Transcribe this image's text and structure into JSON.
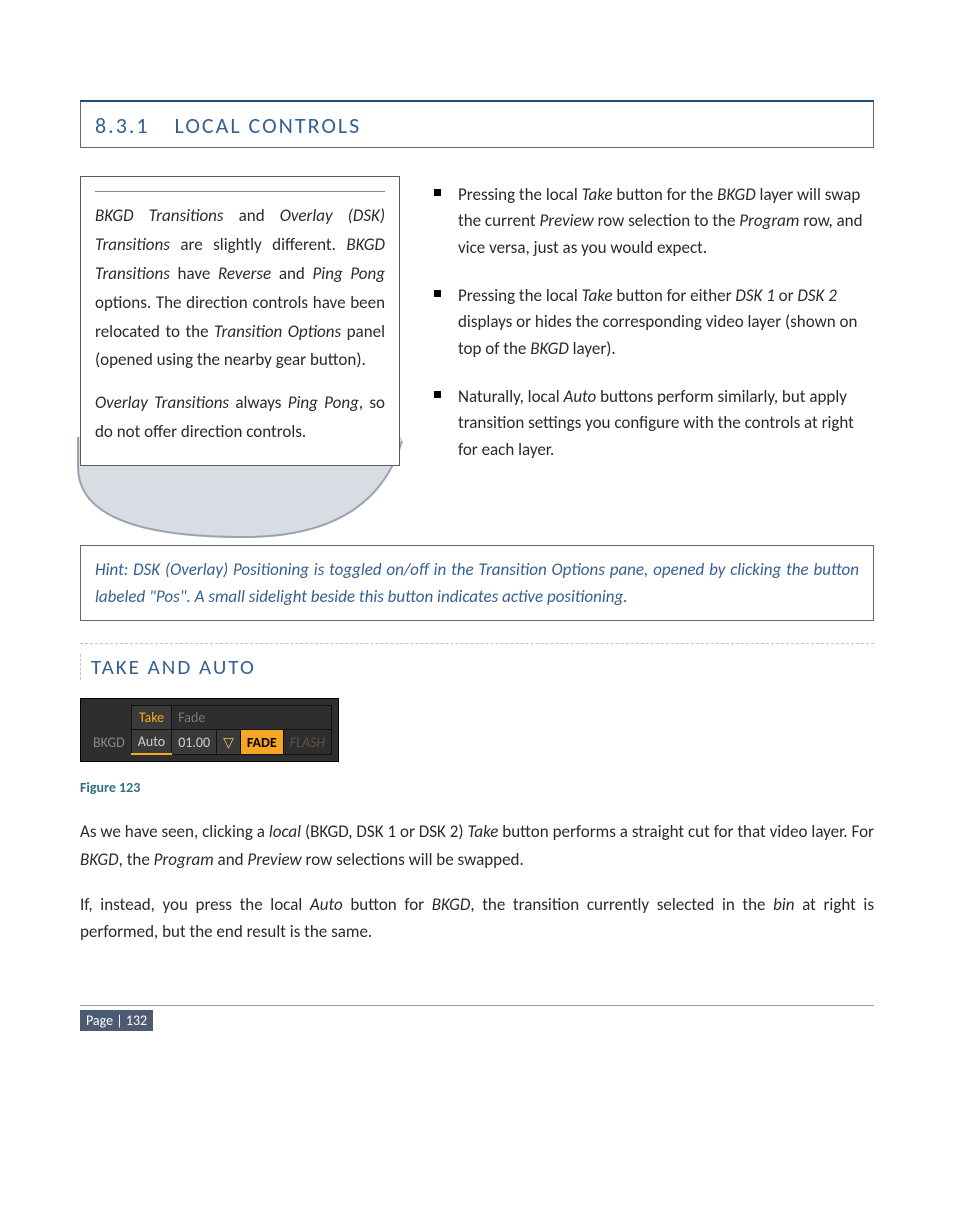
{
  "section": {
    "number": "8.3.1",
    "title": "LOCAL CONTROLS"
  },
  "callout": {
    "p1_html": "<em>BKGD Transitions</em> and <em>Overlay (DSK) Transitions</em> are slightly different. <em>BKGD Transitions</em> have <em>Reverse</em> and <em>Ping Pong</em> options.  The direction controls have been relocated to the <em>Transition Options</em> panel (opened using the nearby gear button).",
    "p2_html": "<em>Overlay Transitions</em> always <em>Ping Pong</em>, so do not offer direction controls."
  },
  "bullets": [
    "Pressing the local <em>Take</em> button for the <em>BKGD</em> layer will swap the current <em>Preview</em> row selection to the <em>Program</em> row, and vice versa, just as you would expect.",
    "Pressing the local <em>Take</em> button for either <em>DSK 1</em> or <em>DSK 2</em> displays or hides the corresponding video layer (shown on top of the <em>BKGD</em> layer).",
    "Naturally, local <em>Auto</em> buttons perform similarly, but apply transition settings you configure with the controls at right for each layer."
  ],
  "hint": "Hint: DSK (Overlay) Positioning is toggled on/off in the Transition Options pane, opened by clicking the button labeled \"Pos\".  A small sidelight beside this button indicates active positioning.",
  "subheading": "TAKE AND AUTO",
  "figure": {
    "row1": {
      "label": "",
      "take": "Take",
      "fade": "Fade"
    },
    "row2": {
      "label": "BKGD",
      "auto": "Auto",
      "value": "01.00",
      "drop": "▽",
      "fade": "FADE",
      "flash": "FLASH"
    },
    "caption": "Figure 123"
  },
  "paragraphs": [
    "As we have seen, clicking a <em>local</em> (BKGD, DSK 1 or DSK 2) <em>Take</em> button performs a straight cut for that video layer.  For <em>BKGD</em>, the <em>Program</em> and <em>Preview</em> row selections will be swapped.",
    "If, instead, you press the local <em>Auto</em> button for <em>BKGD</em>, the transition currently selected in the <em>bin</em> at right is performed, but the end result is the same."
  ],
  "footer": {
    "page_label": "Page | 132"
  }
}
